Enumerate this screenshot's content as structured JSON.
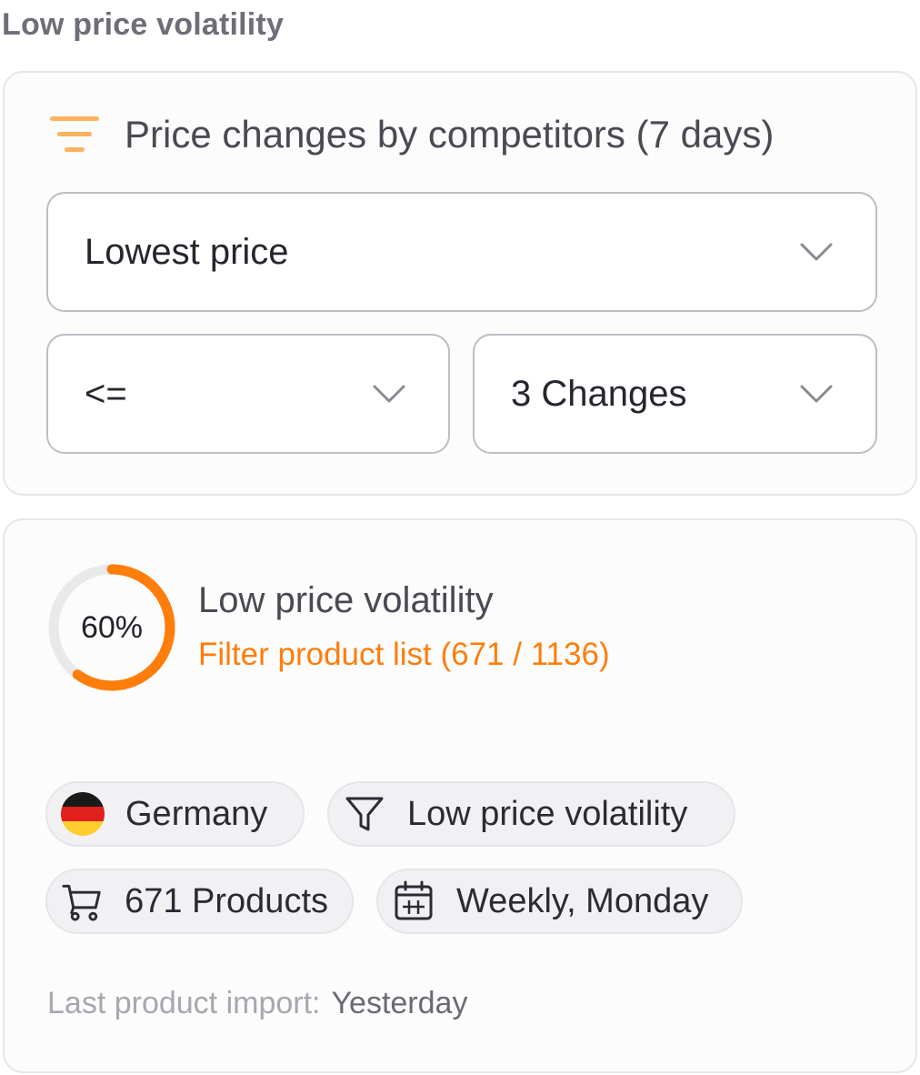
{
  "page": {
    "title": "Low price volatility"
  },
  "filter": {
    "title": "Price changes by competitors (7 days)",
    "icon": "sort-filter-icon",
    "type_select": {
      "value": "Lowest price"
    },
    "operator_select": {
      "value": "<="
    },
    "count_select": {
      "value": "3 Changes"
    }
  },
  "result": {
    "progress_value": 60,
    "progress_label": "60%",
    "title": "Low price volatility",
    "link": "Filter product list (671 / 1136)",
    "chips": {
      "country": {
        "label": "Germany",
        "icon": "germany-flag-icon"
      },
      "filter": {
        "label": "Low price volatility",
        "icon": "funnel-icon"
      },
      "products": {
        "label": "671 Products",
        "icon": "cart-icon"
      },
      "schedule": {
        "label": "Weekly, Monday",
        "icon": "calendar-icon"
      }
    },
    "import": {
      "label": "Last product import:",
      "value": "Yesterday"
    }
  },
  "colors": {
    "accent": "#ff7d0b",
    "accent_light": "#ffb25e",
    "ring_track": "#e9e9ec",
    "border": "#e6e6ea"
  }
}
